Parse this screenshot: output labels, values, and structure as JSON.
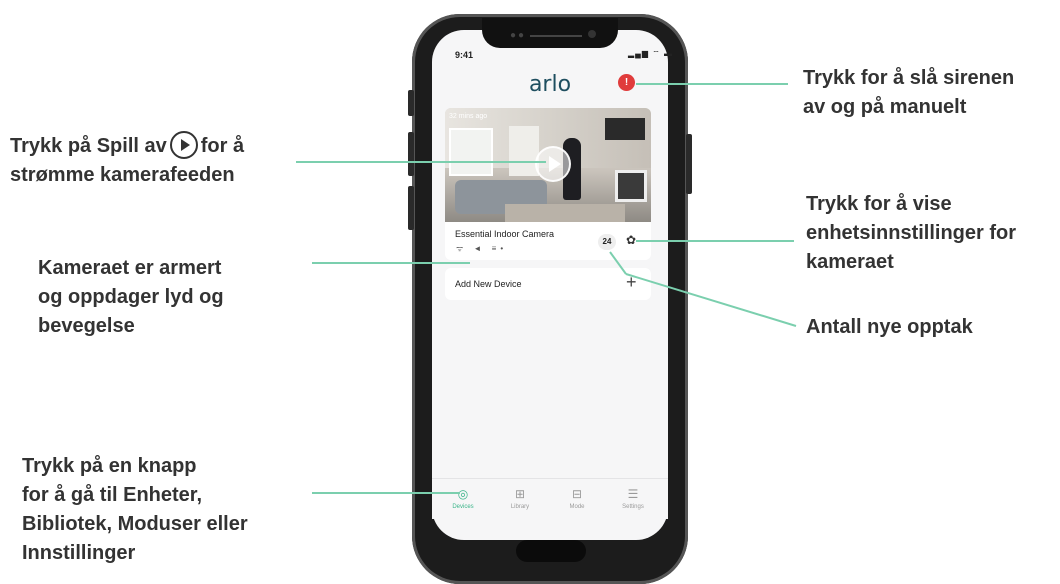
{
  "phone": {
    "status_time": "9:41",
    "status_icons": "▂▄▆ ⌔ ▬",
    "logo": "arlo",
    "siren_icon": "shield-alert-icon",
    "camera_card": {
      "time_ago": "32 mins ago",
      "name": "Essential Indoor Camera",
      "status_icons": "ᯤ ◄ ≡•",
      "clip_count": "24",
      "settings_icon": "✿"
    },
    "add_device": {
      "label": "Add New Device",
      "plus": "+"
    },
    "tabs": [
      {
        "label": "Devices",
        "icon": "◎"
      },
      {
        "label": "Library",
        "icon": "⊞"
      },
      {
        "label": "Mode",
        "icon": "⊟"
      },
      {
        "label": "Settings",
        "icon": "☰"
      }
    ]
  },
  "callouts": {
    "siren": [
      "Trykk for å slå sirenen",
      "av og på manuelt"
    ],
    "play_before": "Trykk på Spill av",
    "play_after": "for å",
    "play_line2": "strømme kamerafeeden",
    "settings": [
      "Trykk for å vise",
      "enhetsinnstillinger for",
      "kameraet"
    ],
    "armed": [
      "Kameraet er armert",
      "og oppdager lyd og",
      "bevegelse"
    ],
    "new_recordings": "Antall nye opptak",
    "navigation": [
      "Trykk på en knapp",
      "for å gå til Enheter,",
      "Bibliotek, Moduser eller",
      "Innstillinger"
    ]
  },
  "colors": {
    "accent": "#3bb58a",
    "line": "#7bcfae",
    "siren": "#e03c3c",
    "text": "#333333"
  }
}
